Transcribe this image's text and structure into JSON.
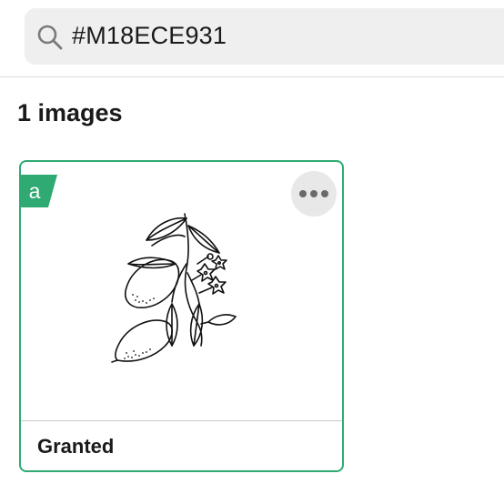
{
  "search": {
    "query": "#M18ECE931",
    "icon": "search-icon"
  },
  "results": {
    "count_label": "1 images"
  },
  "cards": [
    {
      "status": "Granted",
      "badge_letter": "a",
      "badge_icon": "asset-badge-icon",
      "more_icon": "more-options-icon",
      "image_icon": "lemon-branch-illustration",
      "accent_color": "#2eaa72"
    }
  ],
  "colors": {
    "accent": "#2eaa72",
    "search_background": "#efefef",
    "text": "#1a1a1a"
  }
}
